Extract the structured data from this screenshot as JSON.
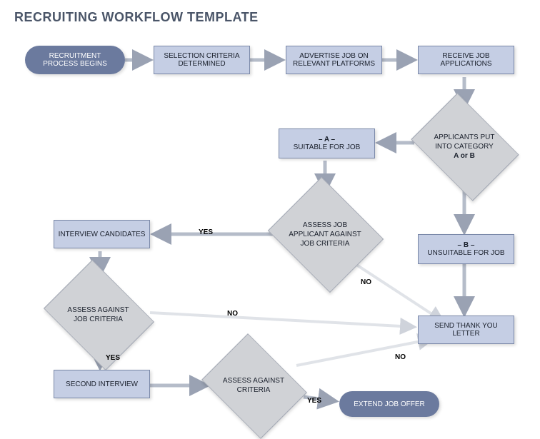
{
  "title": "RECRUITING WORKFLOW TEMPLATE",
  "nodes": {
    "start": "RECRUITMENT PROCESS BEGINS",
    "criteria": "SELECTION CRITERIA DETERMINED",
    "advertise": "ADVERTISE JOB ON RELEVANT PLATFORMS",
    "receive": "RECEIVE JOB APPLICATIONS",
    "category_top": "APPLICANTS PUT INTO CATEGORY",
    "category_bottom": "A or B",
    "suitable_top": "– A –",
    "suitable_bottom": "SUITABLE FOR JOB",
    "unsuitable_top": "– B –",
    "unsuitable_bottom": "UNSUITABLE FOR JOB",
    "assess1": "ASSESS JOB APPLICANT AGAINST JOB CRITERIA",
    "interview": "INTERVIEW CANDIDATES",
    "assess2": "ASSESS AGAINST JOB CRITERIA",
    "second": "SECOND INTERVIEW",
    "assess3": "ASSESS AGAINST CRITERIA",
    "thank": "SEND THANK YOU LETTER",
    "offer": "EXTEND JOB OFFER"
  },
  "labels": {
    "yes": "YES",
    "no": "NO"
  }
}
